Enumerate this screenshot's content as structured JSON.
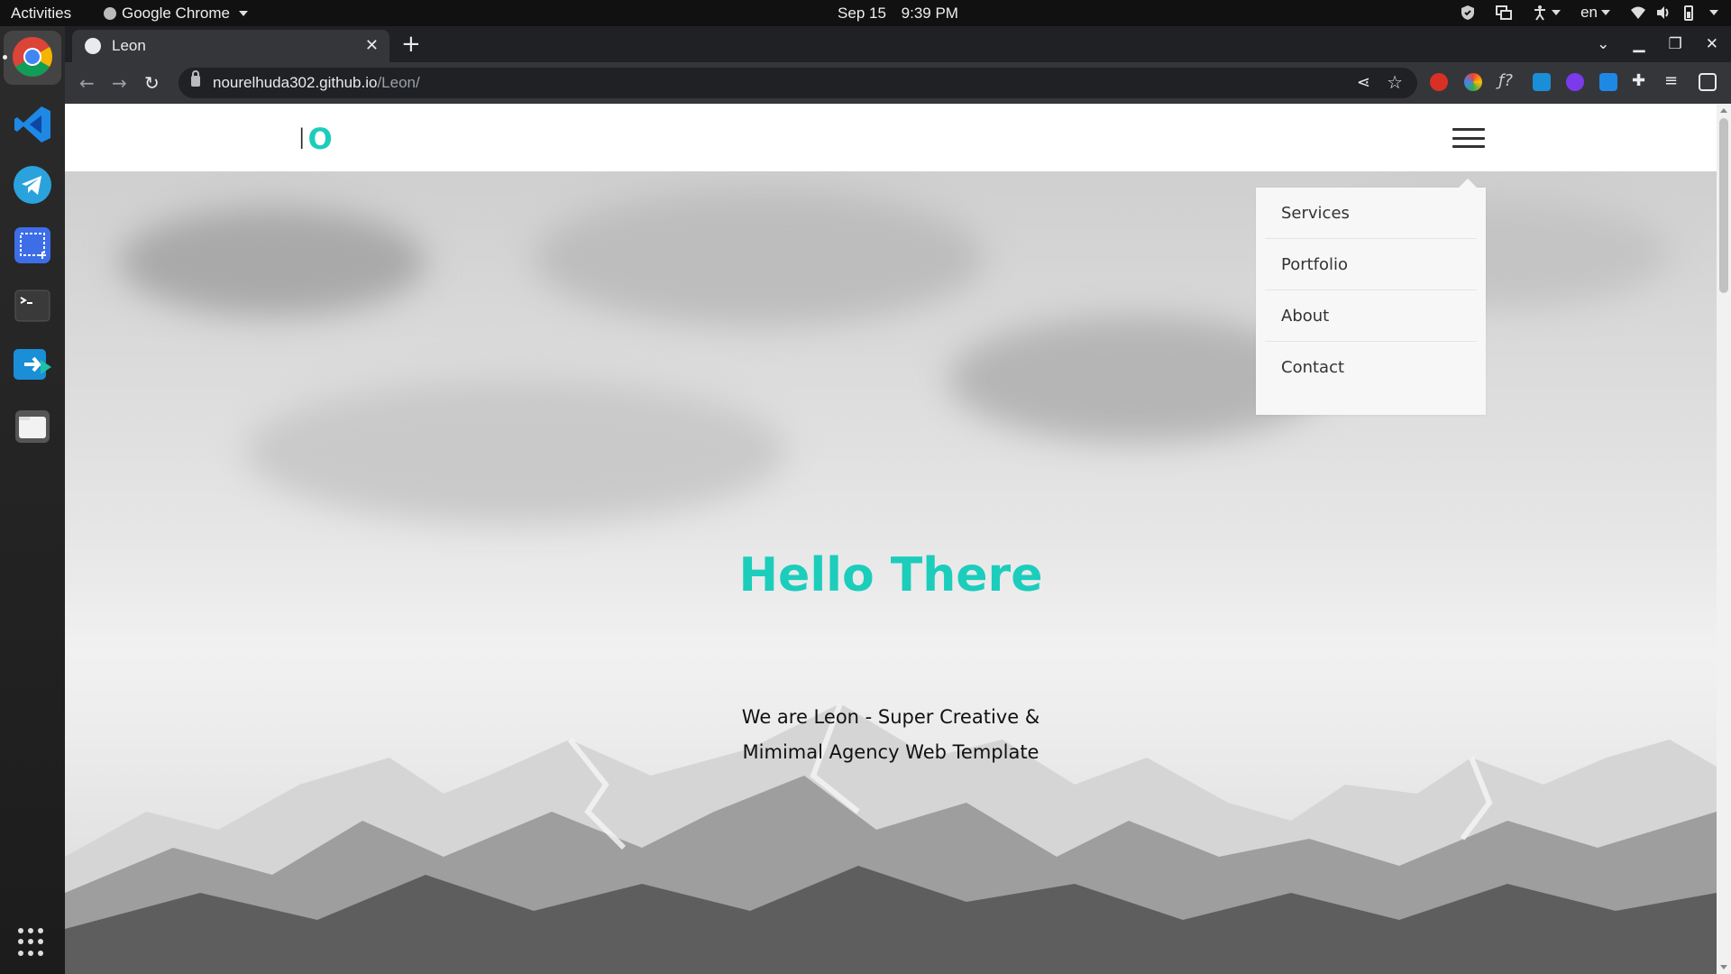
{
  "system": {
    "activities": "Activities",
    "app_name": "Google Chrome",
    "date": "Sep 15",
    "time": "9:39 PM",
    "lang": "en"
  },
  "browser": {
    "tab_title": "Leon",
    "url_host": "nourelhuda302.github.io",
    "url_path": "/Leon/"
  },
  "site": {
    "logo_left": "I",
    "logo_right": "O",
    "menu": [
      "Services",
      "Portfolio",
      "About",
      "Contact"
    ],
    "hero_title": "Hello There",
    "hero_line1": "We are Leon - Super Creative &",
    "hero_line2": "Mimimal Agency Web Template"
  },
  "colors": {
    "accent": "#1ccdbc",
    "chrome_dark": "#202124",
    "chrome_toolbar": "#35363a"
  }
}
